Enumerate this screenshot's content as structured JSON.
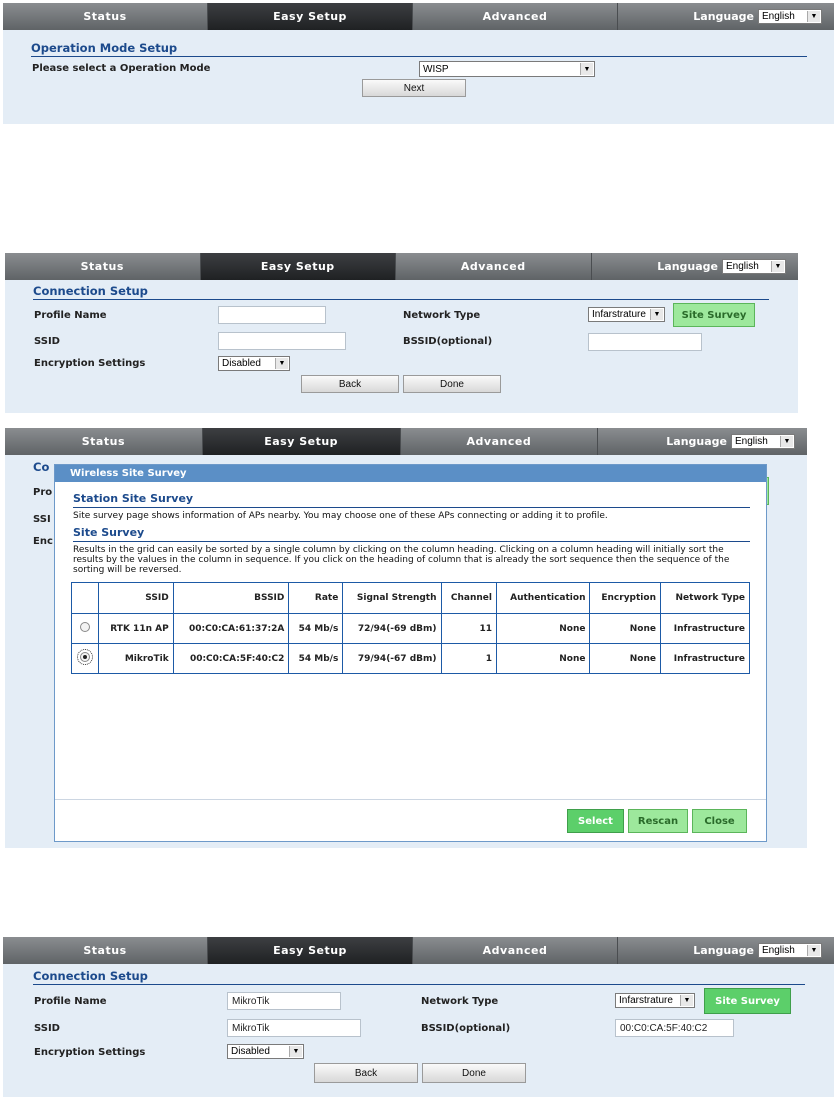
{
  "nav": {
    "tabs": [
      "Status",
      "Easy Setup",
      "Advanced"
    ],
    "active_tab": "Easy Setup",
    "language_label": "Language",
    "language_value": "English"
  },
  "screen1": {
    "section_title": "Operation Mode Setup",
    "select_label": "Please select a Operation Mode",
    "mode_value": "WISP",
    "next_button": "Next"
  },
  "screen2": {
    "section_title": "Connection Setup",
    "profile_name_label": "Profile Name",
    "profile_name_value": "",
    "ssid_label": "SSID",
    "ssid_value": "",
    "encryption_label": "Encryption Settings",
    "encryption_value": "Disabled",
    "network_type_label": "Network Type",
    "network_type_value": "Infarstrature",
    "bssid_label": "BSSID(optional)",
    "bssid_value": "",
    "site_survey_button": "Site Survey",
    "back_button": "Back",
    "done_button": "Done"
  },
  "screen3": {
    "behind_fragments": [
      "Co",
      "Pro",
      "SSI",
      "Enc"
    ],
    "modal": {
      "header": "Wireless Site Survey",
      "station_title": "Station Site Survey",
      "station_text": "Site survey page shows information of APs nearby. You may choose one of these APs connecting or adding it to profile.",
      "survey_title": "Site Survey",
      "survey_text": "Results in the grid can easily be sorted by a single column by clicking on the column heading. Clicking on a column heading will initially sort the results by the values in the column in sequence. If you click on the heading of column that is already the sort sequence then the sequence of the sorting will be reversed.",
      "columns": [
        "SSID",
        "BSSID",
        "Rate",
        "Signal Strength",
        "Channel",
        "Authentication",
        "Encryption",
        "Network Type"
      ],
      "rows": [
        {
          "selected": false,
          "ssid": "RTK 11n AP",
          "bssid": "00:C0:CA:61:37:2A",
          "rate": "54 Mb/s",
          "signal": "72/94(-69 dBm)",
          "channel": "11",
          "auth": "None",
          "encryption": "None",
          "network_type": "Infrastructure"
        },
        {
          "selected": true,
          "ssid": "MikroTik",
          "bssid": "00:C0:CA:5F:40:C2",
          "rate": "54 Mb/s",
          "signal": "79/94(-67 dBm)",
          "channel": "1",
          "auth": "None",
          "encryption": "None",
          "network_type": "Infrastructure"
        }
      ],
      "select_button": "Select",
      "rescan_button": "Rescan",
      "close_button": "Close"
    }
  },
  "screen4": {
    "section_title": "Connection Setup",
    "profile_name_label": "Profile Name",
    "profile_name_value": "MikroTik",
    "ssid_label": "SSID",
    "ssid_value": "MikroTik",
    "encryption_label": "Encryption Settings",
    "encryption_value": "Disabled",
    "network_type_label": "Network Type",
    "network_type_value": "Infarstrature",
    "bssid_label": "BSSID(optional)",
    "bssid_value": "00:C0:CA:5F:40:C2",
    "site_survey_button": "Site Survey",
    "back_button": "Back",
    "done_button": "Done"
  }
}
